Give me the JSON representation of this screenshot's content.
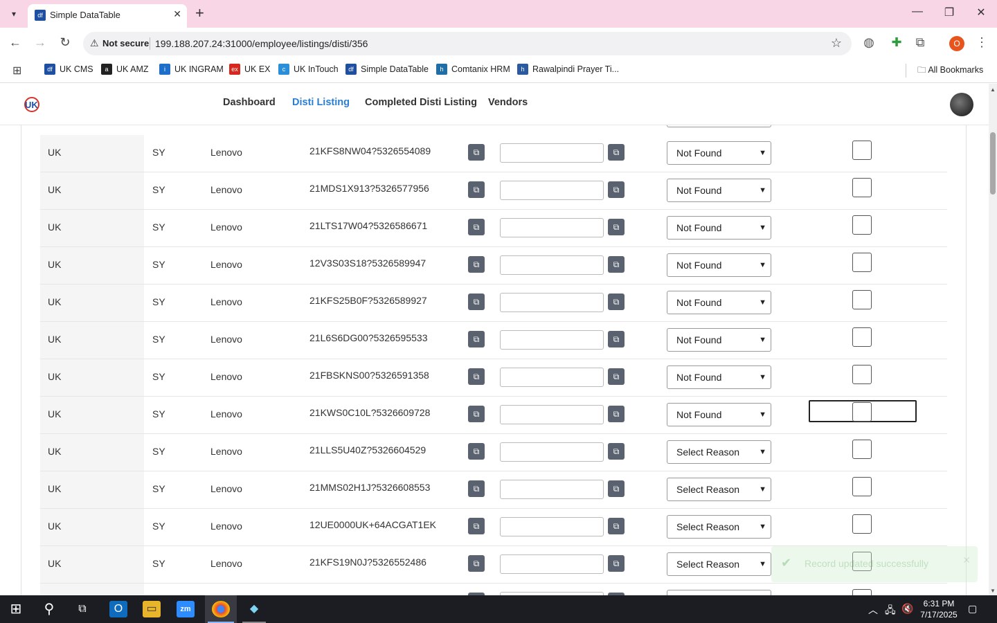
{
  "browser": {
    "tab_title": "Simple DataTable",
    "tab_favicon": "df",
    "not_secure": "Not secure",
    "url": "199.188.207.24:31000/employee/listings/disti/356",
    "profile_letter": "O",
    "bookmarks": [
      {
        "label": "UK CMS",
        "icon": "df",
        "color": "#1e4fa3"
      },
      {
        "label": "UK AMZ",
        "icon": "a",
        "color": "#222"
      },
      {
        "label": "UK INGRAM",
        "icon": "i",
        "color": "#1e6fc9"
      },
      {
        "label": "UK EX",
        "icon": "ex",
        "color": "#d6281f"
      },
      {
        "label": "UK InTouch",
        "icon": "c",
        "color": "#2a8fd8"
      },
      {
        "label": "Simple DataTable",
        "icon": "df",
        "color": "#1e4fa3"
      },
      {
        "label": "Comtanix HRM",
        "icon": "h",
        "color": "#1f6fa6"
      },
      {
        "label": "Rawalpindi Prayer Ti...",
        "icon": "h",
        "color": "#2c5aa0"
      }
    ],
    "all_bookmarks": "All Bookmarks"
  },
  "nav": {
    "links": [
      "Dashboard",
      "Disti Listing",
      "Completed Disti Listing",
      "Vendors"
    ],
    "active": "Disti Listing"
  },
  "table": {
    "rows": [
      {
        "country": "UK",
        "code": "SY",
        "brand": "Lenovo",
        "sku": "21KFS8NW04?5326554089",
        "reason": "Not Found"
      },
      {
        "country": "UK",
        "code": "SY",
        "brand": "Lenovo",
        "sku": "21MDS1X913?5326577956",
        "reason": "Not Found"
      },
      {
        "country": "UK",
        "code": "SY",
        "brand": "Lenovo",
        "sku": "21LTS17W04?5326586671",
        "reason": "Not Found"
      },
      {
        "country": "UK",
        "code": "SY",
        "brand": "Lenovo",
        "sku": "12V3S03S18?5326589947",
        "reason": "Not Found"
      },
      {
        "country": "UK",
        "code": "SY",
        "brand": "Lenovo",
        "sku": "21KFS25B0F?5326589927",
        "reason": "Not Found"
      },
      {
        "country": "UK",
        "code": "SY",
        "brand": "Lenovo",
        "sku": "21L6S6DG00?5326595533",
        "reason": "Not Found"
      },
      {
        "country": "UK",
        "code": "SY",
        "brand": "Lenovo",
        "sku": "21FBSKNS00?5326591358",
        "reason": "Not Found"
      },
      {
        "country": "UK",
        "code": "SY",
        "brand": "Lenovo",
        "sku": "21KWS0C10L?5326609728",
        "reason": "Not Found"
      },
      {
        "country": "UK",
        "code": "SY",
        "brand": "Lenovo",
        "sku": "21LLS5U40Z?5326604529",
        "reason": "Select Reason"
      },
      {
        "country": "UK",
        "code": "SY",
        "brand": "Lenovo",
        "sku": "21MMS02H1J?5326608553",
        "reason": "Select Reason"
      },
      {
        "country": "UK",
        "code": "SY",
        "brand": "Lenovo",
        "sku": "12UE0000UK+64ACGAT1EK",
        "reason": "Select Reason"
      },
      {
        "country": "UK",
        "code": "SY",
        "brand": "Lenovo",
        "sku": "21KFS19N0J?5326552486",
        "reason": "Select Reason"
      }
    ],
    "focused_row_index": 7
  },
  "toast": {
    "message": "Record updated successfully"
  },
  "taskbar": {
    "time": "6:31 PM",
    "date": "7/17/2025"
  }
}
